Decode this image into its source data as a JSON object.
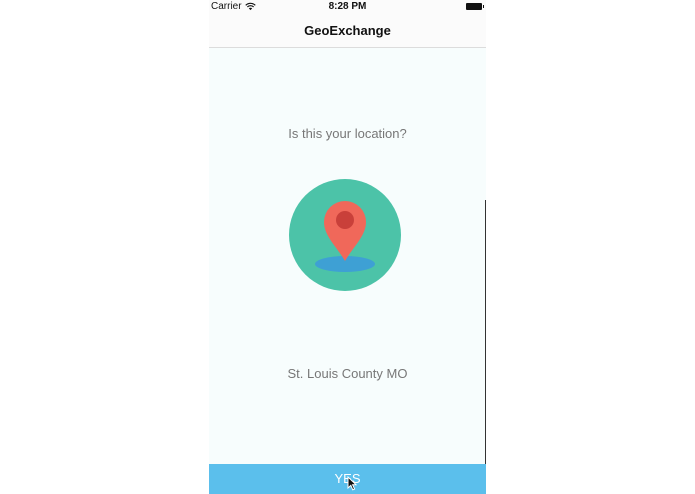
{
  "status_bar": {
    "carrier": "Carrier",
    "time": "8:28 PM",
    "wifi_icon": "wifi-icon",
    "battery_icon": "battery-icon"
  },
  "nav": {
    "title": "GeoExchange"
  },
  "main": {
    "prompt": "Is this your location?",
    "illustration_icon": "map-pin-icon",
    "location_name": "St. Louis County MO"
  },
  "actions": {
    "yes_label": "YES"
  },
  "colors": {
    "circle": "#4cc3a8",
    "pin": "#f0685a",
    "pin_dot": "#c9403a",
    "shadow": "#3ea0d4",
    "button": "#5bbfec",
    "background": "#f7fdfd"
  }
}
